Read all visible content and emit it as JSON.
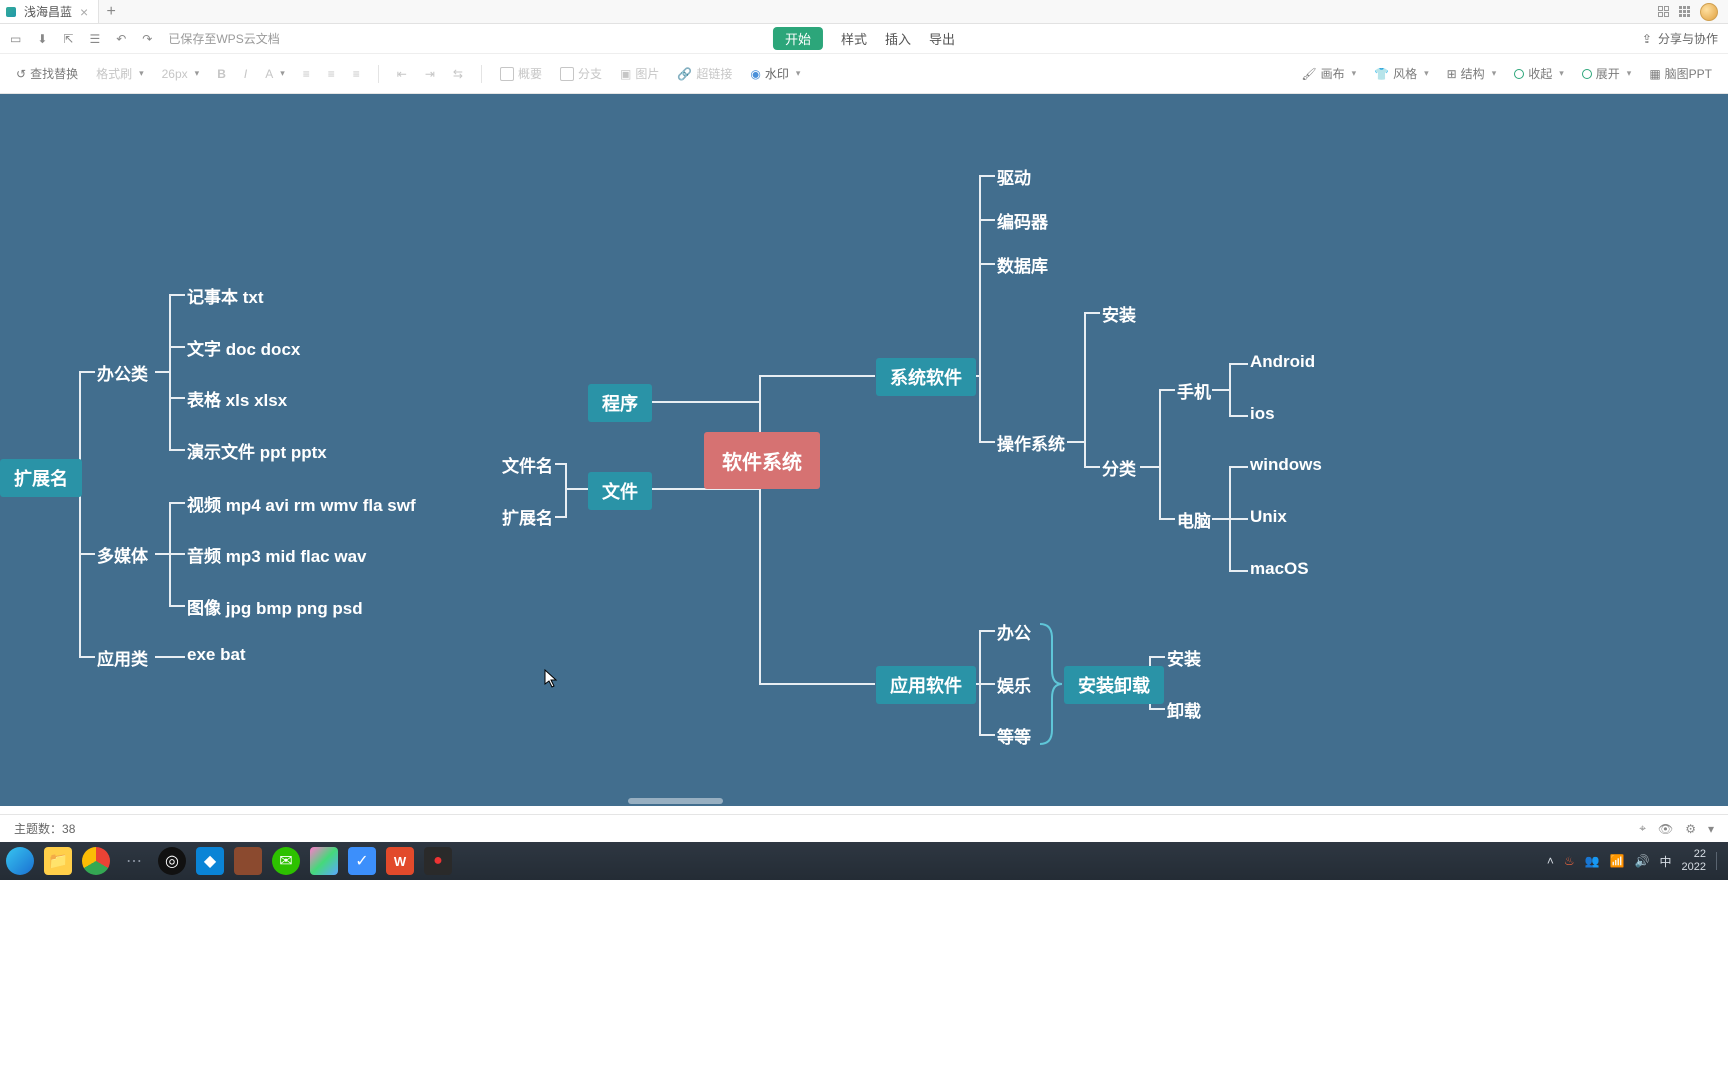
{
  "tab": {
    "title": "浅海昌蓝",
    "close": "×",
    "add": "+"
  },
  "action": {
    "saved": "已保存至WPS云文档",
    "menu": {
      "start": "开始",
      "style": "样式",
      "insert": "插入",
      "export": "导出"
    },
    "share": "分享与协作"
  },
  "ribbon": {
    "find": "查找替换",
    "formatBrush": "格式刷",
    "fontSize": "26px",
    "summary": "概要",
    "subtopic": "分支",
    "picture": "图片",
    "link": "超链接",
    "watermark": "水印",
    "canvasStyle": "画布",
    "themeStyle": "风格",
    "structure": "结构",
    "collapse": "收起",
    "expand": "展开",
    "mindPPT": "脑图PPT"
  },
  "status": {
    "topicCountLabel": "主题数：",
    "topicCount": "38"
  },
  "taskbar": {
    "tray": {
      "ime": "中",
      "time": "22",
      "date": "2022"
    }
  },
  "mindmap": {
    "root": "软件系统",
    "program": "程序",
    "file": "文件",
    "fileChildren": {
      "name": "文件名",
      "ext": "扩展名"
    },
    "extBox": "扩展名",
    "extGroups": {
      "office": {
        "label": "办公类",
        "items": [
          "记事本 txt",
          "文字 doc docx",
          "表格 xls xlsx",
          "演示文件 ppt pptx"
        ]
      },
      "media": {
        "label": "多媒体",
        "items": [
          "视频 mp4 avi rm wmv fla swf",
          "音频 mp3 mid flac wav",
          "图像 jpg bmp png psd"
        ]
      },
      "app": {
        "label": "应用类",
        "item": "exe bat"
      }
    },
    "sysSoft": "系统软件",
    "sysChildren": [
      "驱动",
      "编码器",
      "数据库",
      "操作系统"
    ],
    "osCat": "分类",
    "mobile": {
      "label": "手机",
      "items": [
        "Android",
        "ios"
      ]
    },
    "pc": {
      "label": "电脑",
      "items": [
        "windows",
        "Unix",
        "macOS"
      ]
    },
    "osInstall": "安装",
    "appSoft": "应用软件",
    "appChildren": [
      "办公",
      "娱乐",
      "等等"
    ],
    "installUninstall": "安装卸载",
    "iu": [
      "安装",
      "卸载"
    ]
  }
}
